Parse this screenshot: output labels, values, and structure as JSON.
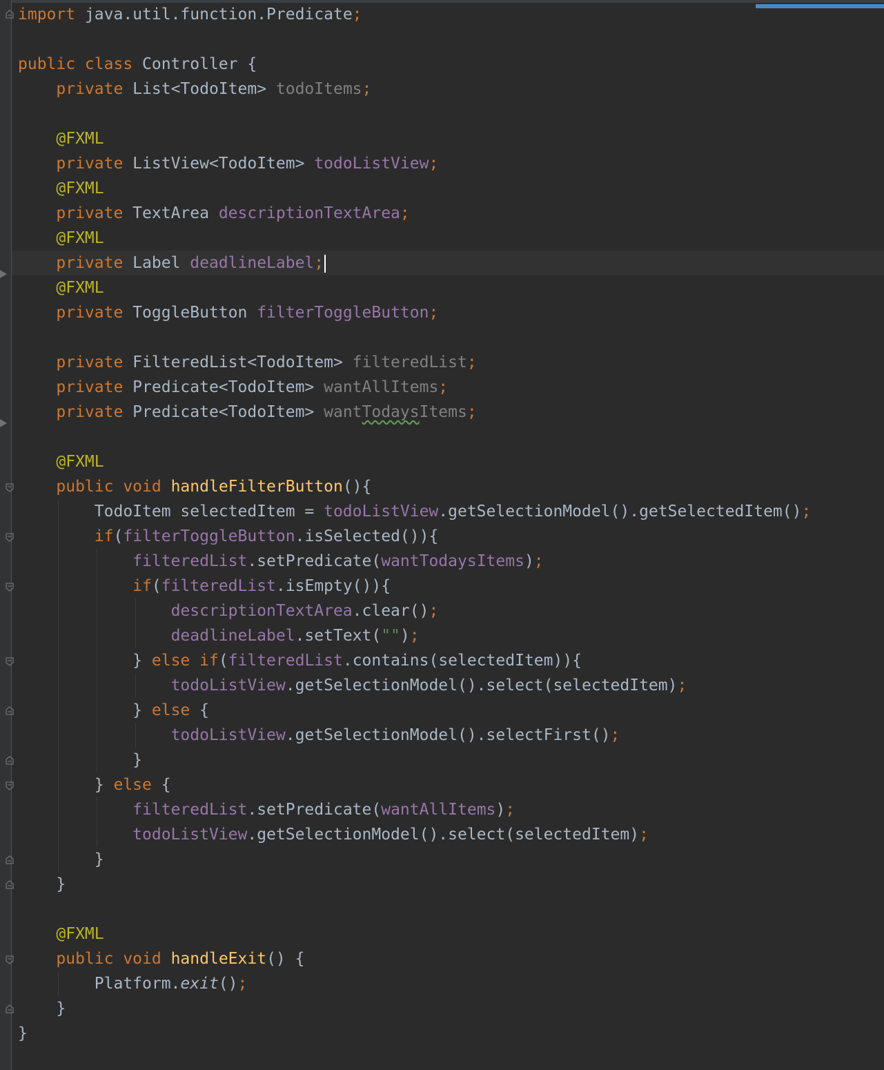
{
  "editor": {
    "language": "java",
    "caret_line": 11,
    "lines": [
      [
        {
          "t": "import",
          "c": "kw"
        },
        {
          "t": " java.util.function.Predicate"
        },
        {
          "t": ";",
          "c": "kw"
        }
      ],
      [],
      [
        {
          "t": "public class",
          "c": "kw"
        },
        {
          "t": " Controller {"
        }
      ],
      [
        {
          "t": "    "
        },
        {
          "t": "private",
          "c": "kw"
        },
        {
          "t": " List<TodoItem> "
        },
        {
          "t": "todoItems",
          "c": "unused"
        },
        {
          "t": ";",
          "c": "kw"
        }
      ],
      [],
      [
        {
          "t": "    "
        },
        {
          "t": "@FXML",
          "c": "ann"
        }
      ],
      [
        {
          "t": "    "
        },
        {
          "t": "private",
          "c": "kw"
        },
        {
          "t": " ListView<TodoItem> "
        },
        {
          "t": "todoListView",
          "c": "fld"
        },
        {
          "t": ";",
          "c": "kw"
        }
      ],
      [
        {
          "t": "    "
        },
        {
          "t": "@FXML",
          "c": "ann"
        }
      ],
      [
        {
          "t": "    "
        },
        {
          "t": "private",
          "c": "kw"
        },
        {
          "t": " TextArea "
        },
        {
          "t": "descriptionTextArea",
          "c": "fld"
        },
        {
          "t": ";",
          "c": "kw"
        }
      ],
      [
        {
          "t": "    "
        },
        {
          "t": "@FXML",
          "c": "ann"
        }
      ],
      [
        {
          "t": "    "
        },
        {
          "t": "private",
          "c": "kw"
        },
        {
          "t": " Label "
        },
        {
          "t": "deadlineLabel",
          "c": "fld"
        },
        {
          "t": ";",
          "c": "kw"
        }
      ],
      [
        {
          "t": "    "
        },
        {
          "t": "@FXML",
          "c": "ann"
        }
      ],
      [
        {
          "t": "    "
        },
        {
          "t": "private",
          "c": "kw"
        },
        {
          "t": " ToggleButton "
        },
        {
          "t": "filterToggleButton",
          "c": "fld"
        },
        {
          "t": ";",
          "c": "kw"
        }
      ],
      [],
      [
        {
          "t": "    "
        },
        {
          "t": "private",
          "c": "kw"
        },
        {
          "t": " FilteredList<TodoItem> "
        },
        {
          "t": "filteredList",
          "c": "unused"
        },
        {
          "t": ";",
          "c": "kw"
        }
      ],
      [
        {
          "t": "    "
        },
        {
          "t": "private",
          "c": "kw"
        },
        {
          "t": " Predicate<TodoItem> "
        },
        {
          "t": "wantAllItems",
          "c": "unused"
        },
        {
          "t": ";",
          "c": "kw"
        }
      ],
      [
        {
          "t": "    "
        },
        {
          "t": "private",
          "c": "kw"
        },
        {
          "t": " Predicate<TodoItem> "
        },
        {
          "t": "want",
          "c": "unused"
        },
        {
          "t": "Todays",
          "c": "unused squig"
        },
        {
          "t": "Items",
          "c": "unused"
        },
        {
          "t": ";",
          "c": "kw"
        }
      ],
      [],
      [
        {
          "t": "    "
        },
        {
          "t": "@FXML",
          "c": "ann"
        }
      ],
      [
        {
          "t": "    "
        },
        {
          "t": "public void",
          "c": "kw"
        },
        {
          "t": " "
        },
        {
          "t": "handleFilterButton",
          "c": "fn"
        },
        {
          "t": "(){"
        }
      ],
      [
        {
          "t": "        TodoItem selectedItem = "
        },
        {
          "t": "todoListView",
          "c": "fld"
        },
        {
          "t": ".getSelectionModel().getSelectedItem()"
        },
        {
          "t": ";",
          "c": "kw"
        }
      ],
      [
        {
          "t": "        "
        },
        {
          "t": "if",
          "c": "kw"
        },
        {
          "t": "("
        },
        {
          "t": "filterToggleButton",
          "c": "fld"
        },
        {
          "t": ".isSelected()){"
        }
      ],
      [
        {
          "t": "            "
        },
        {
          "t": "filteredList",
          "c": "fld"
        },
        {
          "t": ".setPredicate("
        },
        {
          "t": "wantTodaysItems",
          "c": "fld"
        },
        {
          "t": ")"
        },
        {
          "t": ";",
          "c": "kw"
        }
      ],
      [
        {
          "t": "            "
        },
        {
          "t": "if",
          "c": "kw"
        },
        {
          "t": "("
        },
        {
          "t": "filteredList",
          "c": "fld"
        },
        {
          "t": ".isEmpty()){"
        }
      ],
      [
        {
          "t": "                "
        },
        {
          "t": "descriptionTextArea",
          "c": "fld"
        },
        {
          "t": ".clear()"
        },
        {
          "t": ";",
          "c": "kw"
        }
      ],
      [
        {
          "t": "                "
        },
        {
          "t": "deadlineLabel",
          "c": "fld"
        },
        {
          "t": ".setText("
        },
        {
          "t": "\"\"",
          "c": "str"
        },
        {
          "t": ")"
        },
        {
          "t": ";",
          "c": "kw"
        }
      ],
      [
        {
          "t": "            } "
        },
        {
          "t": "else if",
          "c": "kw"
        },
        {
          "t": "("
        },
        {
          "t": "filteredList",
          "c": "fld"
        },
        {
          "t": ".contains(selectedItem)){"
        }
      ],
      [
        {
          "t": "                "
        },
        {
          "t": "todoListView",
          "c": "fld"
        },
        {
          "t": ".getSelectionModel().select(selectedItem)"
        },
        {
          "t": ";",
          "c": "kw"
        }
      ],
      [
        {
          "t": "            } "
        },
        {
          "t": "else",
          "c": "kw"
        },
        {
          "t": " {"
        }
      ],
      [
        {
          "t": "                "
        },
        {
          "t": "todoListView",
          "c": "fld"
        },
        {
          "t": ".getSelectionModel().selectFirst()"
        },
        {
          "t": ";",
          "c": "kw"
        }
      ],
      [
        {
          "t": "            }"
        }
      ],
      [
        {
          "t": "        } "
        },
        {
          "t": "else",
          "c": "kw"
        },
        {
          "t": " {"
        }
      ],
      [
        {
          "t": "            "
        },
        {
          "t": "filteredList",
          "c": "fld"
        },
        {
          "t": ".setPredicate("
        },
        {
          "t": "wantAllItems",
          "c": "fld"
        },
        {
          "t": ")"
        },
        {
          "t": ";",
          "c": "kw"
        }
      ],
      [
        {
          "t": "            "
        },
        {
          "t": "todoListView",
          "c": "fld"
        },
        {
          "t": ".getSelectionModel().select(selectedItem)"
        },
        {
          "t": ";",
          "c": "kw"
        }
      ],
      [
        {
          "t": "        }"
        }
      ],
      [
        {
          "t": "    }"
        }
      ],
      [],
      [
        {
          "t": "    "
        },
        {
          "t": "@FXML",
          "c": "ann"
        }
      ],
      [
        {
          "t": "    "
        },
        {
          "t": "public void",
          "c": "kw"
        },
        {
          "t": " "
        },
        {
          "t": "handleExit",
          "c": "fn"
        },
        {
          "t": "() {"
        }
      ],
      [
        {
          "t": "        Platform."
        },
        {
          "t": "exit",
          "c": "it"
        },
        {
          "t": "()"
        },
        {
          "t": ";",
          "c": "kw"
        }
      ],
      [
        {
          "t": "    }"
        }
      ],
      [
        {
          "t": "}"
        }
      ]
    ]
  }
}
